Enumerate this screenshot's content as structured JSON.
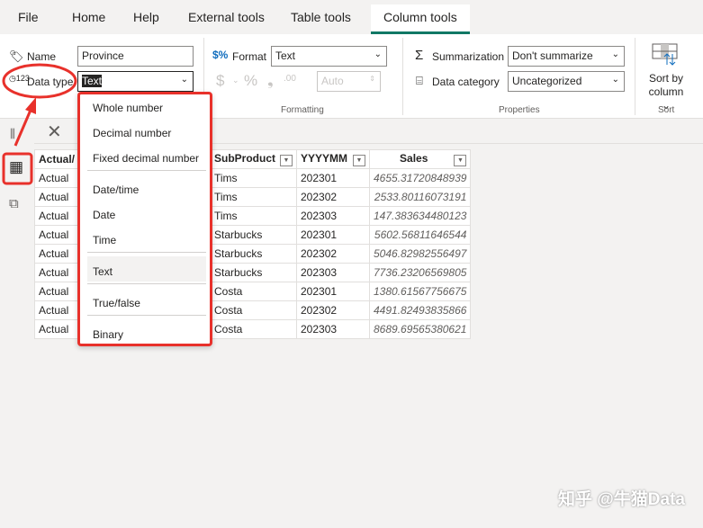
{
  "menu": {
    "tabs": [
      "File",
      "Home",
      "Help",
      "External tools",
      "Table tools",
      "Column tools"
    ],
    "active": "Column tools"
  },
  "ribbon": {
    "name_label": "Name",
    "name_value": "Province",
    "datatype_label": "Data type",
    "datatype_value": "Text",
    "format_label": "Format",
    "format_value": "Text",
    "currency_symbol": "$",
    "percent_symbol": "%",
    "comma_symbol": "❟",
    "decimals_symbol": ".00",
    "auto_value": "Auto",
    "formatting_group": "Formatting",
    "summarization_label": "Summarization",
    "summarization_value": "Don't summarize",
    "category_label": "Data category",
    "category_value": "Uncategorized",
    "properties_group": "Properties",
    "sort_label_1": "Sort by",
    "sort_label_2": "column",
    "sort_group": "Sort"
  },
  "dropdown": {
    "items": [
      "Whole number",
      "Decimal number",
      "Fixed decimal number",
      "Date/time",
      "Date",
      "Time",
      "Text",
      "True/false",
      "Binary"
    ],
    "selected": "Text"
  },
  "table": {
    "headers": [
      "Actual/",
      "SubProduct",
      "YYYYMM",
      "Sales"
    ],
    "rows": [
      [
        "Actual",
        "Tims",
        "202301",
        "4655.31720848939"
      ],
      [
        "Actual",
        "Tims",
        "202302",
        "2533.80116073191"
      ],
      [
        "Actual",
        "Tims",
        "202303",
        "147.383634480123"
      ],
      [
        "Actual",
        "Starbucks",
        "202301",
        "5602.56811646544"
      ],
      [
        "Actual",
        "Starbucks",
        "202302",
        "5046.82982556497"
      ],
      [
        "Actual",
        "Starbucks",
        "202303",
        "7736.23206569805"
      ],
      [
        "Actual",
        "Costa",
        "202301",
        "1380.61567756675"
      ],
      [
        "Actual",
        "Costa",
        "202302",
        "4491.82493835866"
      ],
      [
        "Actual",
        "Costa",
        "202303",
        "8689.69565380621"
      ]
    ]
  },
  "watermark": "知乎 @牛猫Data",
  "colors": {
    "accent": "#117865",
    "annotation": "#e8312b"
  }
}
